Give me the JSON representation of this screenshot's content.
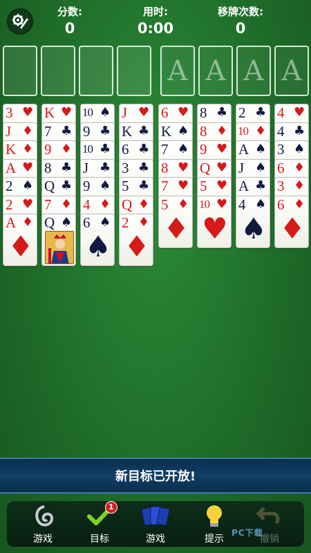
{
  "header": {
    "score_label": "分数:",
    "score_value": "0",
    "time_label": "用时:",
    "time_value": "0:00",
    "moves_label": "移牌次数:",
    "moves_value": "0"
  },
  "free_cells": [
    {
      "label": ""
    },
    {
      "label": ""
    },
    {
      "label": ""
    },
    {
      "label": ""
    }
  ],
  "foundations": [
    {
      "label": "A"
    },
    {
      "label": "A"
    },
    {
      "label": "A"
    },
    {
      "label": "A"
    }
  ],
  "tableau": [
    [
      {
        "rank": "3",
        "suit": "♥",
        "color": "red"
      },
      {
        "rank": "J",
        "suit": "♦",
        "color": "red"
      },
      {
        "rank": "K",
        "suit": "♦",
        "color": "red"
      },
      {
        "rank": "A",
        "suit": "♥",
        "color": "red"
      },
      {
        "rank": "2",
        "suit": "♠",
        "color": "black"
      },
      {
        "rank": "2",
        "suit": "♥",
        "color": "red"
      },
      {
        "rank": "A",
        "suit": "♦",
        "color": "red"
      }
    ],
    [
      {
        "rank": "K",
        "suit": "♥",
        "color": "red"
      },
      {
        "rank": "7",
        "suit": "♣",
        "color": "black"
      },
      {
        "rank": "9",
        "suit": "♦",
        "color": "red"
      },
      {
        "rank": "8",
        "suit": "♣",
        "color": "black"
      },
      {
        "rank": "Q",
        "suit": "♣",
        "color": "black"
      },
      {
        "rank": "7",
        "suit": "♦",
        "color": "red"
      },
      {
        "rank": "Q",
        "suit": "♠",
        "color": "black",
        "face": true
      }
    ],
    [
      {
        "rank": "10",
        "suit": "♠",
        "color": "black"
      },
      {
        "rank": "9",
        "suit": "♣",
        "color": "black"
      },
      {
        "rank": "10",
        "suit": "♣",
        "color": "black"
      },
      {
        "rank": "J",
        "suit": "♣",
        "color": "black"
      },
      {
        "rank": "9",
        "suit": "♠",
        "color": "black"
      },
      {
        "rank": "4",
        "suit": "♦",
        "color": "red"
      },
      {
        "rank": "6",
        "suit": "♠",
        "color": "black"
      }
    ],
    [
      {
        "rank": "J",
        "suit": "♥",
        "color": "red"
      },
      {
        "rank": "K",
        "suit": "♣",
        "color": "black"
      },
      {
        "rank": "6",
        "suit": "♣",
        "color": "black"
      },
      {
        "rank": "3",
        "suit": "♣",
        "color": "black"
      },
      {
        "rank": "5",
        "suit": "♣",
        "color": "black"
      },
      {
        "rank": "Q",
        "suit": "♦",
        "color": "red"
      },
      {
        "rank": "2",
        "suit": "♦",
        "color": "red"
      }
    ],
    [
      {
        "rank": "6",
        "suit": "♥",
        "color": "red"
      },
      {
        "rank": "K",
        "suit": "♠",
        "color": "black"
      },
      {
        "rank": "7",
        "suit": "♠",
        "color": "black"
      },
      {
        "rank": "8",
        "suit": "♥",
        "color": "red"
      },
      {
        "rank": "7",
        "suit": "♥",
        "color": "red"
      },
      {
        "rank": "5",
        "suit": "♦",
        "color": "red"
      }
    ],
    [
      {
        "rank": "8",
        "suit": "♣",
        "color": "black"
      },
      {
        "rank": "8",
        "suit": "♦",
        "color": "red"
      },
      {
        "rank": "9",
        "suit": "♥",
        "color": "red"
      },
      {
        "rank": "Q",
        "suit": "♥",
        "color": "red"
      },
      {
        "rank": "5",
        "suit": "♥",
        "color": "red"
      },
      {
        "rank": "10",
        "suit": "♥",
        "color": "red"
      }
    ],
    [
      {
        "rank": "2",
        "suit": "♣",
        "color": "black"
      },
      {
        "rank": "10",
        "suit": "♦",
        "color": "red"
      },
      {
        "rank": "A",
        "suit": "♠",
        "color": "black"
      },
      {
        "rank": "J",
        "suit": "♠",
        "color": "black"
      },
      {
        "rank": "A",
        "suit": "♣",
        "color": "black"
      },
      {
        "rank": "4",
        "suit": "♠",
        "color": "black"
      }
    ],
    [
      {
        "rank": "4",
        "suit": "♥",
        "color": "red"
      },
      {
        "rank": "4",
        "suit": "♣",
        "color": "black"
      },
      {
        "rank": "3",
        "suit": "♠",
        "color": "black"
      },
      {
        "rank": "6",
        "suit": "♦",
        "color": "red"
      },
      {
        "rank": "3",
        "suit": "♦",
        "color": "red"
      },
      {
        "rank": "6",
        "suit": "♦",
        "color": "red"
      }
    ]
  ],
  "banner": {
    "text": "新目标已开放!"
  },
  "toolbar": {
    "items": [
      {
        "label": "游戏",
        "icon": "swirl-icon",
        "disabled": false
      },
      {
        "label": "目标",
        "icon": "checkmark-icon",
        "badge": "1",
        "disabled": false
      },
      {
        "label": "游戏",
        "icon": "cards-icon",
        "disabled": false
      },
      {
        "label": "提示",
        "icon": "lightbulb-icon",
        "disabled": false
      },
      {
        "label": "撤销",
        "icon": "undo-icon",
        "disabled": true
      }
    ]
  },
  "watermark": {
    "text": "PC下载"
  },
  "colors": {
    "felt": "#1f6d2a",
    "red_suit": "#d51a1a",
    "black_suit": "#12193f",
    "banner": "#103e66"
  }
}
